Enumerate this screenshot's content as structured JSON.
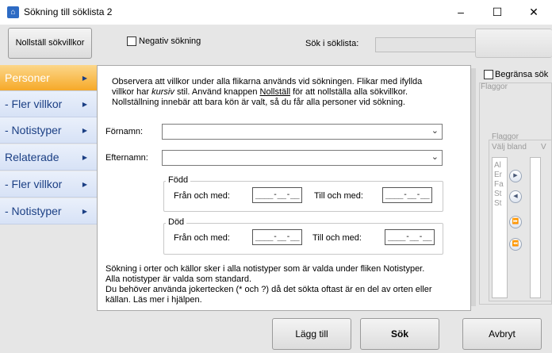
{
  "window": {
    "title": "Sökning till söklista 2",
    "app_icon_glyph": "⌂",
    "min_glyph": "–",
    "max_glyph": "☐",
    "close_glyph": "✕"
  },
  "top": {
    "reset_button": "Nollställ sökvillkor",
    "negative_label": "Negativ sökning",
    "search_in_list_label": "Sök i söklista:"
  },
  "sidebar": {
    "items": [
      {
        "label": "Personer"
      },
      {
        "label": "- Fler villkor"
      },
      {
        "label": "- Notistyper"
      },
      {
        "label": "Relaterade"
      },
      {
        "label": "- Fler villkor"
      },
      {
        "label": "- Notistyper"
      }
    ],
    "arrow": "▶"
  },
  "panel": {
    "info_lines": [
      "Observera att villkor under alla flikarna används vid sökningen. Flikar med ifyllda",
      "villkor har",
      "kursiv",
      "stil. Använd knappen",
      "Nollställ",
      "för att nollställa alla sökvillkor.",
      "Nollställning innebär att bara kön är valt, så du får alla personer vid sökning."
    ],
    "firstname_label": "Förnamn:",
    "lastname_label": "Efternamn:",
    "born": {
      "title": "Född",
      "from_label": "Från och med:",
      "to_label": "Till och med:",
      "from_value": "____-__-__",
      "to_value": "____-__-__"
    },
    "died": {
      "title": "Död",
      "from_label": "Från och med:",
      "to_label": "Till och med:",
      "from_value": "____-__-__",
      "to_value": "____-__-__"
    },
    "footer_lines": [
      "Sökning i orter och källor sker i alla notistyper som är valda under fliken Notistyper.",
      "Alla notistyper är valda som standard.",
      "Du behöver använda jokertecken (* och ?) då det sökta oftast är en del av orten eller",
      "källan. Läs mer i hjälpen."
    ]
  },
  "right": {
    "limit_label": "Begränsa sök",
    "flags_label_1": "Flaggor",
    "flags_label_2": "Flaggor",
    "choose_label": "Välj bland",
    "v_label": "V",
    "list_items": [
      "Al",
      "Er",
      "Fa",
      "St",
      "St"
    ]
  },
  "buttons": {
    "add": "Lägg till",
    "search": "Sök",
    "cancel": "Avbryt"
  }
}
